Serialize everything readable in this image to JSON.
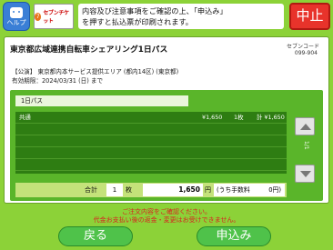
{
  "topbar": {
    "help_label": "ヘルプ",
    "brand_text": "セブンチケット",
    "brand_logo": "7",
    "message_line1": "内容及び注意事項をご確認の上、「申込み」",
    "message_line2": "を押すと払込票が印刷されます。",
    "quit_label": "中止"
  },
  "ticket": {
    "title": "東京都広域連携自転車シェアリング1日パス",
    "code_label": "セブンコード",
    "code_value": "099-904",
    "subtitle": "【公演】 東京都内本サービス提供エリア (都内14区) (東京都)",
    "validity": "有効期限：2024/03/31 (日) まで"
  },
  "order": {
    "category_tab": "1日パス",
    "rows": [
      {
        "name": "共通",
        "price": "¥1,650",
        "qty": "1枚",
        "subtotal": "計 ¥1,650"
      },
      {
        "name": "",
        "price": "",
        "qty": "",
        "subtotal": ""
      },
      {
        "name": "",
        "price": "",
        "qty": "",
        "subtotal": ""
      },
      {
        "name": "",
        "price": "",
        "qty": "",
        "subtotal": ""
      },
      {
        "name": "",
        "price": "",
        "qty": "",
        "subtotal": ""
      }
    ],
    "page_indicator": "1/1",
    "total_label": "合計",
    "total_qty": "1",
    "total_unit": "枚",
    "total_amount": "1,650",
    "yen": "円",
    "fee_label": "(うち手数料",
    "fee_value": "0円)"
  },
  "notice": {
    "line1": "ご注文内容をご確認ください。",
    "line2": "代金お支払い後の返金・変更はお受けできません。"
  },
  "buttons": {
    "back_label": "戻る",
    "apply_label": "申込み"
  },
  "colors": {
    "background": "#8cd238",
    "quit": "#e8332b",
    "action_button": "#4fc24a",
    "notice_text": "#d92020"
  }
}
